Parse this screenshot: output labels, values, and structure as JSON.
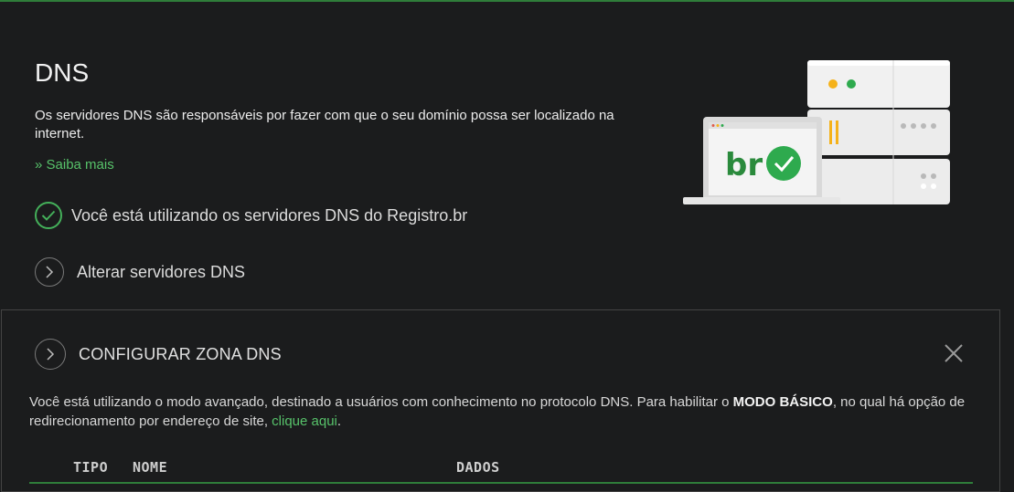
{
  "header": {
    "title": "DNS",
    "description": "Os servidores DNS são responsáveis por fazer com que o seu domínio possa ser localizado na internet.",
    "learn_more": "» Saiba mais",
    "status": "Você está utilizando os servidores DNS do Registro.br",
    "change_servers": "Alterar servidores DNS"
  },
  "illustration": {
    "laptop_label": "br",
    "icons": [
      "server-stack-icon",
      "laptop-icon",
      "check-badge-icon"
    ]
  },
  "zone_panel": {
    "title": "CONFIGURAR ZONA DNS",
    "info_before": "Você está utilizando o modo avançado, destinado a usuários com conhecimento no protocolo DNS. Para habilitar o ",
    "info_bold": "MODO BÁSICO",
    "info_middle": ", no qual há opção de redirecionamento por endereço de site, ",
    "info_link": "clique aqui",
    "info_after": ".",
    "table_headers": [
      "TIPO",
      "NOME",
      "DADOS"
    ]
  },
  "colors": {
    "background": "#1b1c1d",
    "accent_green": "#57c26a",
    "check_green": "#44b05a",
    "divider_green": "#2f7d3a"
  }
}
